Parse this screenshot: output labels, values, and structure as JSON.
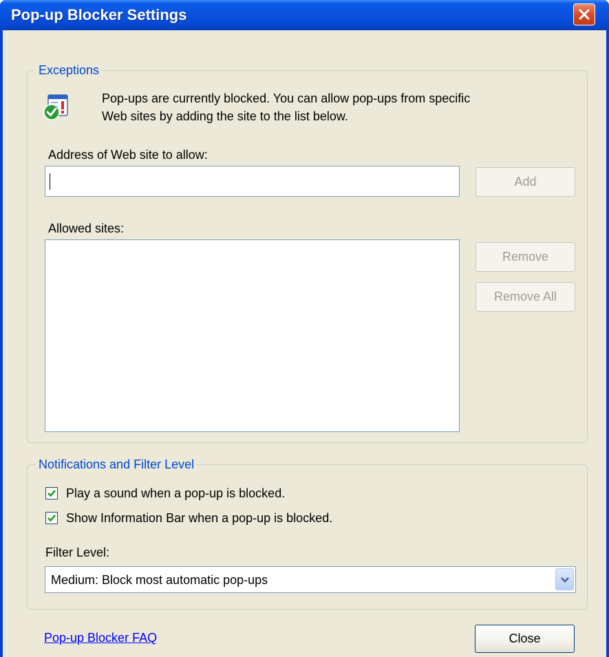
{
  "window": {
    "title": "Pop-up Blocker Settings"
  },
  "exceptions": {
    "legend": "Exceptions",
    "info_line1": "Pop-ups are currently blocked.  You can allow pop-ups from specific",
    "info_line2": "Web sites by adding the site to the list below.",
    "address_label": "Address of Web site to allow:",
    "address_value": "",
    "add_button": "Add",
    "allowed_label": "Allowed sites:",
    "allowed_sites": [],
    "remove_button": "Remove",
    "remove_all_button": "Remove All"
  },
  "notifications": {
    "legend": "Notifications and Filter Level",
    "play_sound_label": "Play a sound when a pop-up is blocked.",
    "play_sound_checked": true,
    "show_infobar_label": "Show Information Bar when a pop-up is blocked.",
    "show_infobar_checked": true,
    "filter_level_label": "Filter Level:",
    "filter_level_value": "Medium: Block most automatic pop-ups"
  },
  "footer": {
    "faq_link": "Pop-up Blocker FAQ",
    "close_button": "Close"
  },
  "colors": {
    "titlebar": "#0a52de",
    "dialog_bg": "#ece9d8",
    "legend_text": "#0046d5",
    "close_x_bg": "#d8502c"
  }
}
